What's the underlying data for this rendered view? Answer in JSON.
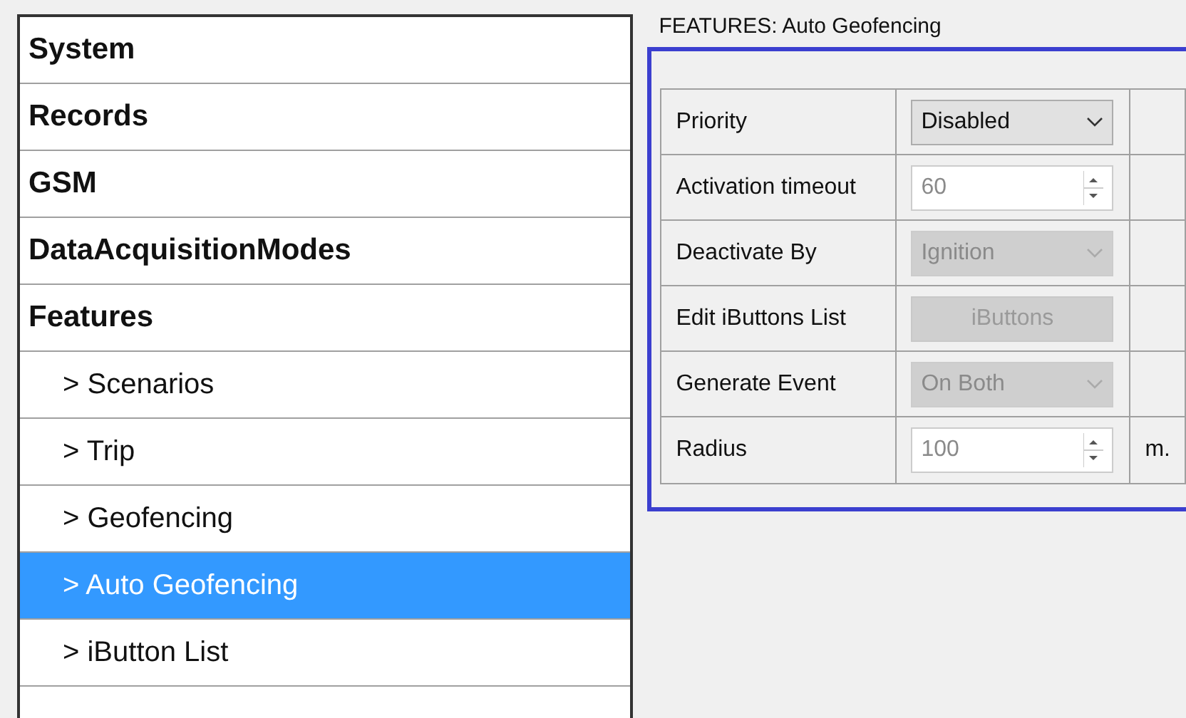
{
  "sidebar": {
    "items": [
      {
        "label": "System",
        "kind": "section",
        "selected": false
      },
      {
        "label": "Records",
        "kind": "section",
        "selected": false
      },
      {
        "label": "GSM",
        "kind": "section",
        "selected": false
      },
      {
        "label": "DataAcquisitionModes",
        "kind": "section",
        "selected": false
      },
      {
        "label": "Features",
        "kind": "section",
        "selected": false
      },
      {
        "label": "> Scenarios",
        "kind": "sub",
        "selected": false
      },
      {
        "label": "> Trip",
        "kind": "sub",
        "selected": false
      },
      {
        "label": "> Geofencing",
        "kind": "sub",
        "selected": false
      },
      {
        "label": "> Auto Geofencing",
        "kind": "sub",
        "selected": true
      },
      {
        "label": "> iButton List",
        "kind": "sub",
        "selected": false
      }
    ]
  },
  "panel": {
    "title": "FEATURES: Auto Geofencing",
    "rows": [
      {
        "label": "Priority",
        "kind": "select",
        "value": "Disabled",
        "disabled": false
      },
      {
        "label": "Activation timeout",
        "kind": "spin",
        "value": "60",
        "disabled": true
      },
      {
        "label": "Deactivate By",
        "kind": "select",
        "value": "Ignition",
        "disabled": true
      },
      {
        "label": "Edit iButtons List",
        "kind": "button",
        "value": "iButtons",
        "disabled": true
      },
      {
        "label": "Generate Event",
        "kind": "select",
        "value": "On Both",
        "disabled": true
      },
      {
        "label": "Radius",
        "kind": "spin",
        "value": "100",
        "disabled": true,
        "unit": "m."
      }
    ]
  }
}
